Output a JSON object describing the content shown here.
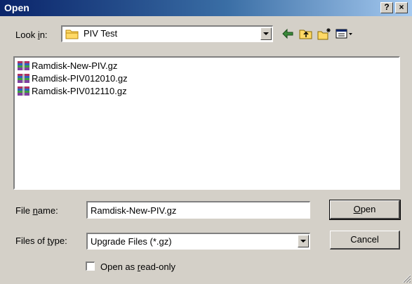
{
  "window": {
    "title": "Open",
    "help_glyph": "?",
    "close_glyph": "×"
  },
  "look_in": {
    "label_pre": "Look ",
    "label_key": "i",
    "label_post": "n:",
    "value": "PIV Test",
    "icon": "folder-icon"
  },
  "toolbar": {
    "icons": [
      "back-arrow-icon",
      "up-folder-icon",
      "new-folder-icon",
      "view-menu-icon"
    ]
  },
  "files": [
    {
      "name": "Ramdisk-New-PIV.gz",
      "icon": "archive-icon"
    },
    {
      "name": "Ramdisk-PIV012010.gz",
      "icon": "archive-icon"
    },
    {
      "name": "Ramdisk-PIV012110.gz",
      "icon": "archive-icon"
    }
  ],
  "file_name": {
    "label_pre": "File ",
    "label_key": "n",
    "label_post": "ame:",
    "value": "Ramdisk-New-PIV.gz"
  },
  "file_type": {
    "label_pre": "Files of ",
    "label_key": "t",
    "label_post": "ype:",
    "value": "Upgrade Files (*.gz)"
  },
  "buttons": {
    "open_key": "O",
    "open_rest": "pen",
    "cancel": "Cancel"
  },
  "read_only": {
    "label_pre": "Open as ",
    "label_key": "r",
    "label_post": "ead-only",
    "checked": false
  },
  "colors": {
    "title_bar_start": "#0a246a",
    "title_bar_end": "#a6caf0",
    "dialog_face": "#d4d0c8"
  }
}
